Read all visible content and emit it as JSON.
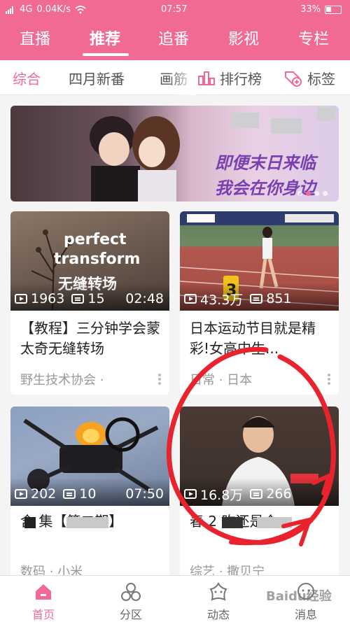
{
  "status_bar": {
    "network": "4G",
    "speed": "0.04K/s",
    "time": "07:57",
    "battery": "33%"
  },
  "top_nav": {
    "tabs": [
      {
        "label": "直播"
      },
      {
        "label": "推荐",
        "active": true
      },
      {
        "label": "追番"
      },
      {
        "label": "影视"
      },
      {
        "label": "专栏"
      }
    ]
  },
  "sub_tabs": {
    "items": [
      {
        "label": "综合",
        "active": true
      },
      {
        "label": "四月新番"
      },
      {
        "label": "画筋"
      }
    ],
    "ranking_label": "排行榜",
    "tags_label": "标签"
  },
  "banner": {
    "line1": "即便末日来临",
    "line2": "我会在你身边"
  },
  "cards": [
    {
      "thumb_text1": "perfect",
      "thumb_text2": "transform",
      "thumb_text3": "无缝转场",
      "views": "1963",
      "danmaku": "15",
      "duration": "02:48",
      "title": "【教程】三分钟学会蒙太奇无缝转场",
      "meta": "野生技术协会 ·"
    },
    {
      "views": "43.3万",
      "danmaku": "851",
      "duration": "",
      "title": "日本运动节目就是精彩!女高中生...",
      "meta": "日常 · 日本"
    },
    {
      "views": "202",
      "danmaku": "10",
      "duration": "07:50",
      "title": "含 集【第二期】",
      "meta": "数码 · 小米"
    },
    {
      "views": "16.8万",
      "danmaku": "266",
      "duration": "",
      "title": "春 2 昨还是个",
      "meta": "综艺 · 撒贝宁"
    }
  ],
  "bottom_nav": [
    {
      "label": "首页",
      "active": true
    },
    {
      "label": "分区"
    },
    {
      "label": "动态"
    },
    {
      "label": "消息"
    }
  ],
  "watermark": "Baidu经验",
  "colors": {
    "accent": "#f06a94",
    "annotation": "#e8232d"
  }
}
